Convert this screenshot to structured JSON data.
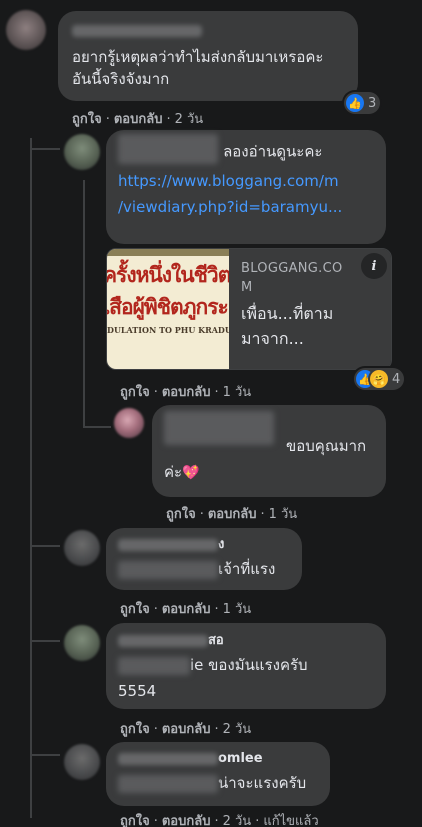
{
  "actions": {
    "like": "ถูกใจ",
    "sep": "·",
    "reply": "ตอบกลับ",
    "edited": "แก้ไขแล้ว"
  },
  "comments": [
    {
      "lines": [
        "อยากรู้เหตุผลว่าทำไมส่งกลับมาเหรอคะ",
        "อันนี้จริงจังมาก"
      ],
      "time": "2 วัน",
      "reactions": {
        "icons": [
          "like-icon"
        ],
        "count": "3"
      }
    },
    {
      "text": "ลองอ่านดูนะคะ",
      "link_lines": [
        "https://www.bloggang.com/m",
        "/viewdiary.php?id=baramyu..."
      ],
      "preview": {
        "domain_line1": "BLOGGANG.CO",
        "domain_line2": "M",
        "title_line1": "เพื่อน...ที่ตาม",
        "title_line2": "มาจาก...",
        "image_text_line1": "ครั้งหนึ่งในชีวิต",
        "image_text_line2": "เสือผู้พิชิตภูกระ",
        "image_text_line3": "DULATION TO PHU KRADUENG CO",
        "info_icon": "i"
      },
      "time": "1 วัน",
      "reactions": {
        "icons": [
          "like-icon",
          "care-icon"
        ],
        "count": "4"
      }
    },
    {
      "text": "ขอบคุณมาก",
      "text2": "ค่ะ",
      "time": "1 วัน"
    },
    {
      "name_suffix": "ง",
      "text": "เจ้าที่แรง",
      "time": "1 วัน"
    },
    {
      "name_suffix": "สอ",
      "text": "ie ของมันแรงครับ",
      "text2": "5554",
      "time": "2 วัน"
    },
    {
      "name_suffix": "omlee",
      "text": "น่าจะแรงครับ",
      "time": "2 วัน"
    }
  ],
  "colors": {
    "background": "#18191a",
    "bubble": "#3a3b3c",
    "link": "#4599ff",
    "meta": "#b0b3b8",
    "like": "#1877f2"
  }
}
